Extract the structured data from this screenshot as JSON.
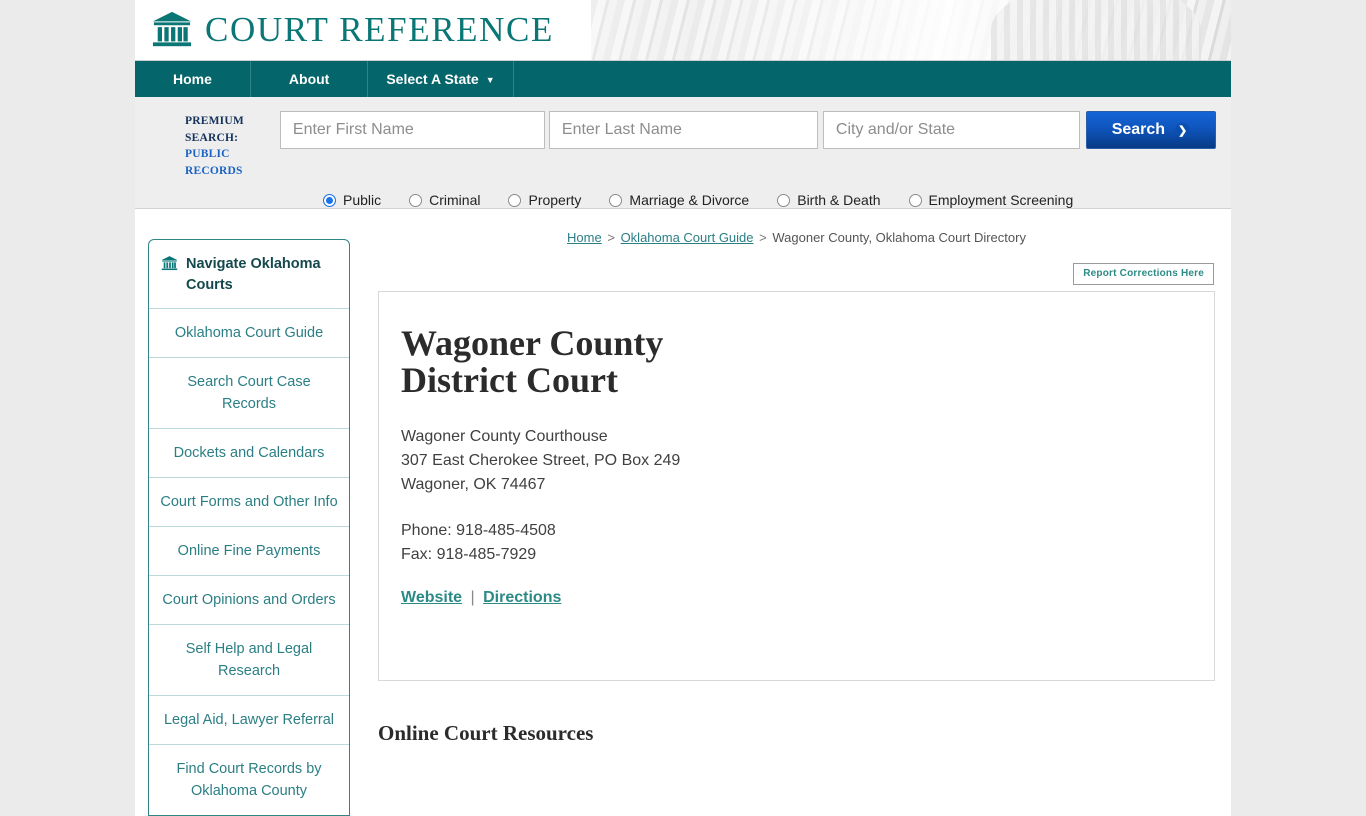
{
  "site": {
    "brand_name": "COURT REFERENCE",
    "brand_icon": "courthouse-icon"
  },
  "nav": {
    "items": [
      {
        "label": "Home"
      },
      {
        "label": "About"
      },
      {
        "label": "Select A State",
        "caret": "▼"
      }
    ]
  },
  "search": {
    "premium_line1": "PREMIUM SEARCH:",
    "premium_line2": "PUBLIC RECORDS",
    "first_name_placeholder": "Enter First Name",
    "first_name_value": "",
    "last_name_placeholder": "Enter Last Name",
    "last_name_value": "",
    "city_state_placeholder": "City and/or State",
    "city_state_value": "",
    "button_label": "Search",
    "button_icon": "chevron-right-icon",
    "radios": [
      {
        "label": "Public",
        "checked": true
      },
      {
        "label": "Criminal",
        "checked": false
      },
      {
        "label": "Property",
        "checked": false
      },
      {
        "label": "Marriage & Divorce",
        "checked": false
      },
      {
        "label": "Birth & Death",
        "checked": false
      },
      {
        "label": "Employment Screening",
        "checked": false
      }
    ]
  },
  "breadcrumb": {
    "home": "Home",
    "guide": "Oklahoma Court Guide",
    "current": "Wagoner County, Oklahoma Court Directory",
    "separator": ">"
  },
  "corrections": {
    "label": "Report Corrections Here"
  },
  "sidebar": {
    "header_icon": "courthouse-icon",
    "header": "Navigate Oklahoma Courts",
    "items": [
      {
        "label": "Oklahoma Court Guide"
      },
      {
        "label": "Search Court Case Records"
      },
      {
        "label": "Dockets and Calendars"
      },
      {
        "label": "Court Forms and Other Info"
      },
      {
        "label": "Online Fine Payments"
      },
      {
        "label": "Court Opinions and Orders"
      },
      {
        "label": "Self Help and Legal Research"
      },
      {
        "label": "Legal Aid, Lawyer Referral"
      },
      {
        "label": "Find Court Records by Oklahoma County"
      }
    ]
  },
  "court": {
    "title": "Wagoner County District Court",
    "address": [
      "Wagoner County Courthouse",
      "307 East Cherokee Street, PO Box 249",
      "Wagoner, OK 74467"
    ],
    "phone": "Phone: 918-485-4508",
    "fax": "Fax: 918-485-7929",
    "website_link": "Website",
    "directions_link": "Directions",
    "link_separator": "|"
  },
  "resources": {
    "title": "Online Court Resources"
  },
  "colors": {
    "teal": "#0b7676",
    "nav_teal": "#04666a",
    "link_teal": "#2b7f84",
    "search_blue": "#0f55bd",
    "premium_navy": "#16335c",
    "premium_blue": "#1b63c4"
  }
}
